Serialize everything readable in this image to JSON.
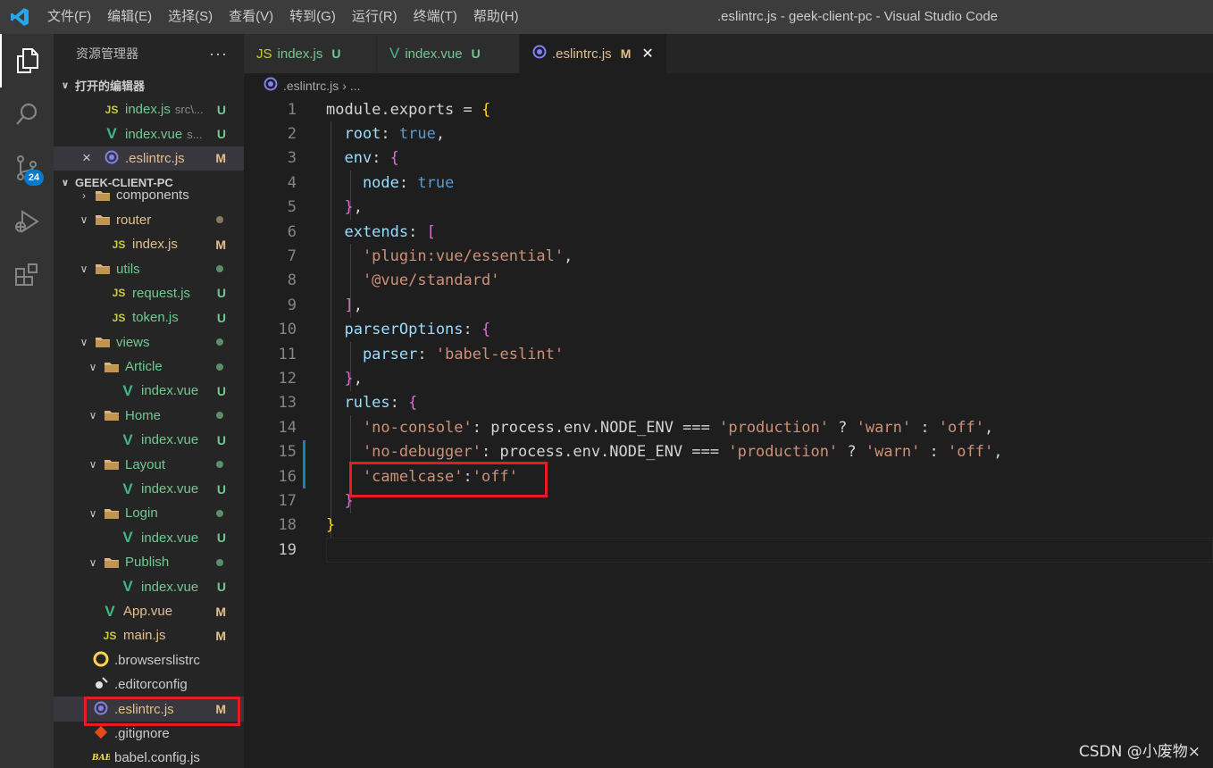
{
  "titlebar": {
    "menu": [
      "文件(F)",
      "编辑(E)",
      "选择(S)",
      "查看(V)",
      "转到(G)",
      "运行(R)",
      "终端(T)",
      "帮助(H)"
    ],
    "window_title": ".eslintrc.js - geek-client-pc - Visual Studio Code"
  },
  "activity": {
    "items": [
      "explorer-icon",
      "search-icon",
      "source-control-icon",
      "run-debug-icon",
      "extensions-icon"
    ],
    "scm_badge": "24"
  },
  "sidebar": {
    "title": "资源管理器",
    "more": "···",
    "open_editors_title": "打开的编辑器",
    "open_editors": [
      {
        "name": "index.js",
        "desc": "src\\...",
        "status": "U",
        "icon": "JS"
      },
      {
        "name": "index.vue",
        "desc": "s...",
        "status": "U",
        "icon": "V"
      },
      {
        "name": ".eslintrc.js",
        "desc": "",
        "status": "M",
        "icon": "eslint",
        "close": "×"
      }
    ],
    "project_title": "GEEK-CLIENT-PC",
    "tree": [
      {
        "name": "components",
        "type": "folder",
        "depth": 1,
        "status": ""
      },
      {
        "name": "router",
        "type": "folder",
        "depth": 1,
        "status": "dot-gray"
      },
      {
        "name": "index.js",
        "type": "js",
        "depth": 2,
        "status": "M"
      },
      {
        "name": "utils",
        "type": "folder",
        "depth": 1,
        "status": "dot-green"
      },
      {
        "name": "request.js",
        "type": "js",
        "depth": 2,
        "status": "U"
      },
      {
        "name": "token.js",
        "type": "js",
        "depth": 2,
        "status": "U"
      },
      {
        "name": "views",
        "type": "folder",
        "depth": 1,
        "status": "dot-green"
      },
      {
        "name": "Article",
        "type": "folder",
        "depth": 2,
        "status": "dot-green"
      },
      {
        "name": "index.vue",
        "type": "vue",
        "depth": 3,
        "status": "U"
      },
      {
        "name": "Home",
        "type": "folder",
        "depth": 2,
        "status": "dot-green"
      },
      {
        "name": "index.vue",
        "type": "vue",
        "depth": 3,
        "status": "U"
      },
      {
        "name": "Layout",
        "type": "folder",
        "depth": 2,
        "status": "dot-green"
      },
      {
        "name": "index.vue",
        "type": "vue",
        "depth": 3,
        "status": "U"
      },
      {
        "name": "Login",
        "type": "folder",
        "depth": 2,
        "status": "dot-green"
      },
      {
        "name": "index.vue",
        "type": "vue",
        "depth": 3,
        "status": "U"
      },
      {
        "name": "Publish",
        "type": "folder",
        "depth": 2,
        "status": "dot-green"
      },
      {
        "name": "index.vue",
        "type": "vue",
        "depth": 3,
        "status": "U"
      },
      {
        "name": "App.vue",
        "type": "vue",
        "depth": 1,
        "status": "M"
      },
      {
        "name": "main.js",
        "type": "js",
        "depth": 1,
        "status": "M"
      },
      {
        "name": ".browserslistrc",
        "type": "browserslist",
        "depth": 0,
        "status": ""
      },
      {
        "name": ".editorconfig",
        "type": "editorconfig",
        "depth": 0,
        "status": ""
      },
      {
        "name": ".eslintrc.js",
        "type": "eslint",
        "depth": 0,
        "status": "M"
      },
      {
        "name": ".gitignore",
        "type": "git",
        "depth": 0,
        "status": ""
      },
      {
        "name": "babel.config.js",
        "type": "babel",
        "depth": 0,
        "status": ""
      }
    ]
  },
  "tabs": [
    {
      "name": "index.js",
      "status": "U",
      "icon": "JS",
      "active": false
    },
    {
      "name": "index.vue",
      "status": "U",
      "icon": "V",
      "active": false
    },
    {
      "name": ".eslintrc.js",
      "status": "M",
      "icon": "eslint",
      "active": true,
      "close": "✕"
    }
  ],
  "breadcrumb": {
    "file": ".eslintrc.js",
    "rest": "..."
  },
  "editor": {
    "current_line": 19,
    "lines": [
      [
        [
          "module.exports = ",
          "plain"
        ],
        [
          "{",
          "br1"
        ]
      ],
      [
        [
          "  root",
          "prop"
        ],
        [
          ": ",
          "plain"
        ],
        [
          "true",
          "bool"
        ],
        [
          ",",
          "plain"
        ]
      ],
      [
        [
          "  env",
          "prop"
        ],
        [
          ": ",
          "plain"
        ],
        [
          "{",
          "br2"
        ]
      ],
      [
        [
          "    node",
          "prop"
        ],
        [
          ": ",
          "plain"
        ],
        [
          "true",
          "bool"
        ]
      ],
      [
        [
          "  ",
          "plain"
        ],
        [
          "}",
          "br2"
        ],
        [
          ",",
          "plain"
        ]
      ],
      [
        [
          "  extends",
          "prop"
        ],
        [
          ": ",
          "plain"
        ],
        [
          "[",
          "br2"
        ]
      ],
      [
        [
          "    'plugin:vue/essential'",
          "str"
        ],
        [
          ",",
          "plain"
        ]
      ],
      [
        [
          "    '@vue/standard'",
          "str"
        ]
      ],
      [
        [
          "  ",
          "plain"
        ],
        [
          "]",
          "br2"
        ],
        [
          ",",
          "plain"
        ]
      ],
      [
        [
          "  parserOptions",
          "prop"
        ],
        [
          ": ",
          "plain"
        ],
        [
          "{",
          "br2"
        ]
      ],
      [
        [
          "    parser",
          "prop"
        ],
        [
          ": ",
          "plain"
        ],
        [
          "'babel-eslint'",
          "str"
        ]
      ],
      [
        [
          "  ",
          "plain"
        ],
        [
          "}",
          "br2"
        ],
        [
          ",",
          "plain"
        ]
      ],
      [
        [
          "  rules",
          "prop"
        ],
        [
          ": ",
          "plain"
        ],
        [
          "{",
          "br2"
        ]
      ],
      [
        [
          "    'no-console'",
          "str"
        ],
        [
          ": process.env.NODE_ENV === ",
          "plain"
        ],
        [
          "'production'",
          "str"
        ],
        [
          " ? ",
          "plain"
        ],
        [
          "'warn'",
          "str"
        ],
        [
          " : ",
          "plain"
        ],
        [
          "'off'",
          "str"
        ],
        [
          ",",
          "plain"
        ]
      ],
      [
        [
          "    'no-debugger'",
          "str"
        ],
        [
          ": process.env.NODE_ENV === ",
          "plain"
        ],
        [
          "'production'",
          "str"
        ],
        [
          " ? ",
          "plain"
        ],
        [
          "'warn'",
          "str"
        ],
        [
          " : ",
          "plain"
        ],
        [
          "'off'",
          "str"
        ],
        [
          ",",
          "plain"
        ]
      ],
      [
        [
          "    'camelcase'",
          "str"
        ],
        [
          ":",
          "plain"
        ],
        [
          "'off'",
          "str"
        ]
      ],
      [
        [
          "  ",
          "plain"
        ],
        [
          "}",
          "br2"
        ]
      ],
      [
        [
          "}",
          "br1"
        ]
      ],
      []
    ]
  },
  "colors": {
    "titlebar": "#3c3c3c",
    "activitybar": "#333333",
    "sidebar": "#252526",
    "editor": "#1e1e1e",
    "highlight_box": "#e51c23",
    "badge": "#007acc"
  },
  "watermark": "CSDN @小废物×"
}
